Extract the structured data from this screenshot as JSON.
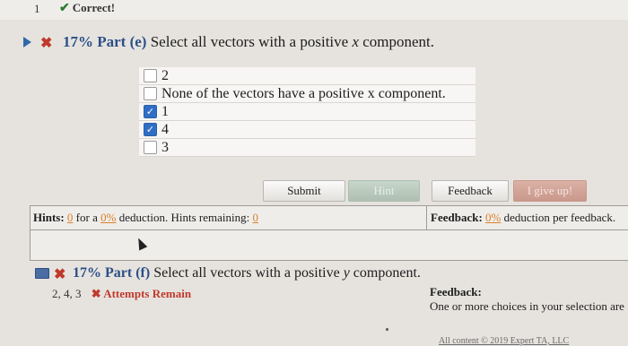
{
  "header": {
    "question_number": "1",
    "status_label": "Correct!"
  },
  "part_e": {
    "weight": "17%",
    "part_label": "Part (e)",
    "prompt_pre": "Select all vectors with a positive",
    "prompt_var": "x",
    "prompt_post": "component.",
    "options": [
      {
        "label": "2",
        "checked": false
      },
      {
        "label": "None of the vectors have a positive x component.",
        "checked": false
      },
      {
        "label": "1",
        "checked": true
      },
      {
        "label": "4",
        "checked": true
      },
      {
        "label": "3",
        "checked": false
      }
    ]
  },
  "buttons": {
    "submit": "Submit",
    "hint": "Hint",
    "feedback": "Feedback",
    "give_up": "I give up!"
  },
  "hints": {
    "label": "Hints:",
    "count": "0",
    "for_a": "for a",
    "percent": "0%",
    "deduction_text": "deduction. Hints remaining:",
    "remaining": "0"
  },
  "feedback_info": {
    "label": "Feedback:",
    "percent": "0%",
    "text": "deduction per feedback."
  },
  "part_f": {
    "weight": "17%",
    "part_label": "Part (f)",
    "prompt_pre": "Select all vectors with a positive",
    "prompt_var": "y",
    "prompt_post": "component.",
    "answer": "2, 4, 3",
    "attempts": "Attempts Remain",
    "feedback_title": "Feedback:",
    "feedback_text": "One or more choices in your selection are"
  },
  "footer": {
    "text": "All content © 2019 Expert TA, LLC"
  },
  "colors": {
    "accent_blue": "#2c4f86",
    "error_red": "#c0392b",
    "orange": "#d9822b",
    "correct_green": "#2e7d2e"
  }
}
